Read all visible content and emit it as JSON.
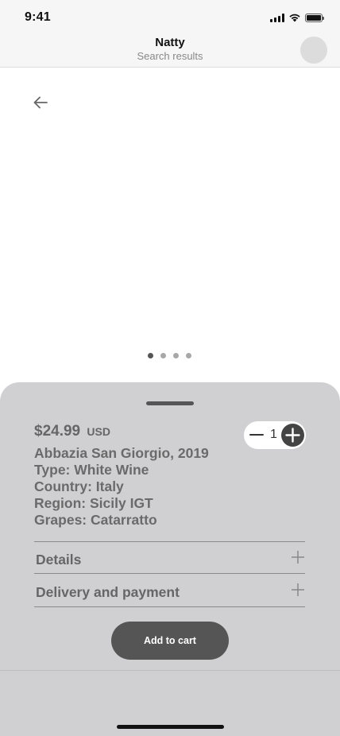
{
  "status_bar": {
    "time": "9:41",
    "icons": [
      "signal-icon",
      "wifi-icon",
      "battery-icon"
    ]
  },
  "header": {
    "title": "Natty",
    "subtitle": "Search results",
    "avatar": "avatar"
  },
  "gallery": {
    "back_icon": "arrow-left-icon",
    "page_count": 4,
    "active_page": 1
  },
  "product": {
    "price": "$24.99",
    "currency": "USD",
    "name": "Abbazia San Giorgio, 2019",
    "type": "Type: White Wine",
    "country": "Country: Italy",
    "region": "Region: Sicily IGT",
    "grapes": "Grapes: Catarratto"
  },
  "quantity": {
    "value": "1",
    "minus_icon": "minus-icon",
    "plus_icon": "plus-circle-icon"
  },
  "sections": {
    "details": "Details",
    "delivery": "Delivery and payment"
  },
  "actions": {
    "add_to_cart": "Add to cart"
  },
  "colors": {
    "sheet_background": "#d0d0d2",
    "button_background": "#555555",
    "header_background": "#f6f6f6"
  }
}
